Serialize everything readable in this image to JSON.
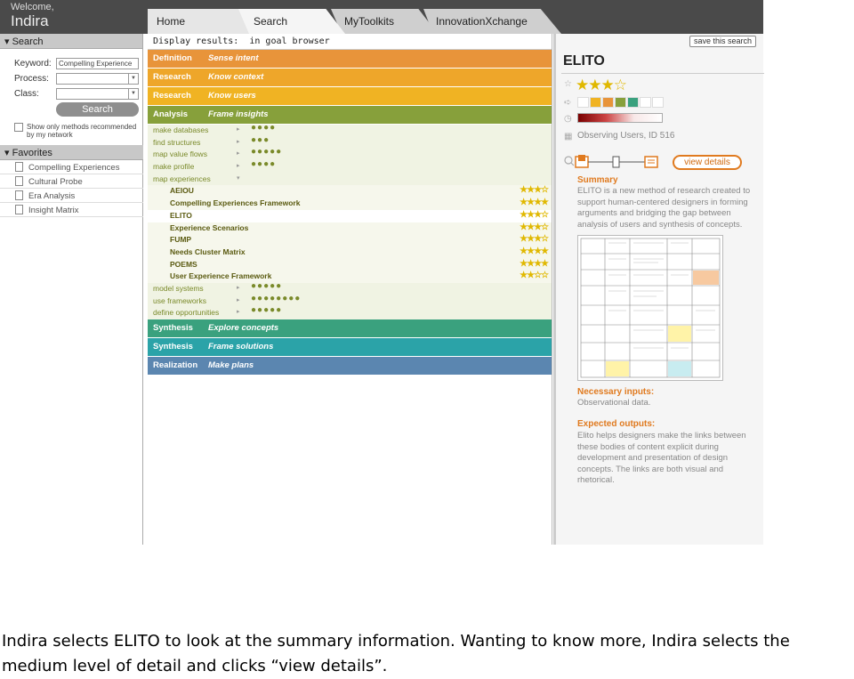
{
  "header": {
    "welcome": "Welcome,",
    "user": "Indira"
  },
  "tabs": [
    {
      "label": "Home"
    },
    {
      "label": "Search"
    },
    {
      "label": "MyToolkits"
    },
    {
      "label": "InnovationXchange"
    }
  ],
  "sidebar": {
    "search_title": "Search",
    "keyword_label": "Keyword:",
    "keyword_value": "Compelling Experience",
    "process_label": "Process:",
    "class_label": "Class:",
    "search_button": "Search",
    "network_option": "Show only methods recommended by my network",
    "favorites_title": "Favorites",
    "favorites": [
      {
        "label": "Compelling Experiences"
      },
      {
        "label": "Cultural Probe"
      },
      {
        "label": "Era Analysis"
      },
      {
        "label": "Insight Matrix"
      }
    ]
  },
  "main": {
    "display_label": "Display results:",
    "display_value": "in goal browser",
    "bands_top": [
      {
        "name": "Definition",
        "sub": "Sense intent",
        "color": "#e8943a"
      },
      {
        "name": "Research",
        "sub": "Know context",
        "color": "#eea62a"
      },
      {
        "name": "Research",
        "sub": "Know users",
        "color": "#f0b323"
      },
      {
        "name": "Analysis",
        "sub": "Frame insights",
        "color": "#87a03b"
      }
    ],
    "methods_before": [
      {
        "name": "make databases",
        "dots": "●●●●"
      },
      {
        "name": "find structures",
        "dots": "●●●"
      },
      {
        "name": "map value flows",
        "dots": "●●●●●"
      },
      {
        "name": "make profile",
        "dots": "●●●●"
      }
    ],
    "expanded_method": {
      "name": "map experiences",
      "arrow": "▾"
    },
    "submethods": [
      {
        "name": "AEIOU",
        "stars": "★★★☆"
      },
      {
        "name": "Compelling Experiences Framework",
        "stars": "★★★★"
      },
      {
        "name": "ELITO",
        "stars": "★★★☆"
      },
      {
        "name": "Experience Scenarios",
        "stars": "★★★☆"
      },
      {
        "name": "FUMP",
        "stars": "★★★☆"
      },
      {
        "name": "Needs Cluster Matrix",
        "stars": "★★★★"
      },
      {
        "name": "POEMS",
        "stars": "★★★★"
      },
      {
        "name": "User Experience Framework",
        "stars": "★★☆☆"
      }
    ],
    "methods_after": [
      {
        "name": "model systems",
        "dots": "●●●●●"
      },
      {
        "name": "use frameworks",
        "dots": "●●●●●●●●"
      },
      {
        "name": "define opportunities",
        "dots": "●●●●●"
      }
    ],
    "bands_bottom": [
      {
        "name": "Synthesis",
        "sub": "Explore concepts",
        "color": "#3aa17e"
      },
      {
        "name": "Synthesis",
        "sub": "Frame solutions",
        "color": "#2ba3a8"
      },
      {
        "name": "Realization",
        "sub": "Make plans",
        "color": "#5b86b0"
      }
    ]
  },
  "detail": {
    "save_search": "save this search",
    "title": "ELITO",
    "stars": "★★★☆",
    "swatch_colors": [
      "#ffffff",
      "#f0b323",
      "#e8943a",
      "#87a03b",
      "#3aa17e",
      "#ffffff",
      "#ffffff"
    ],
    "observing": "Observing Users, ID 516",
    "view_details": "view details",
    "summary_title": "Summary",
    "summary_text": "ELITO is a new method of research created to support human-centered designers in forming arguments and bridging the gap between analysis of users and synthesis of concepts.",
    "inputs_title": "Necessary inputs:",
    "inputs_text": "Observational data.",
    "outputs_title": "Expected outputs:",
    "outputs_text": "Elito helps designers make the links between these bodies of content explicit during development and presentation of design concepts. The links are both visual and rhetorical."
  },
  "caption": "Indira selects ELITO to look at the summary information. Wanting to know more, Indira selects the medium level of detail and clicks “view details”."
}
